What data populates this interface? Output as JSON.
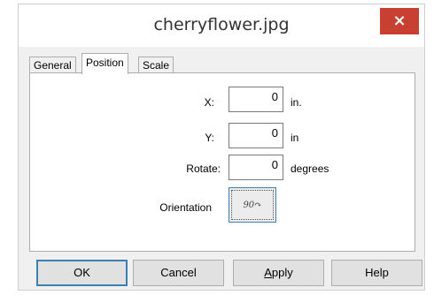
{
  "window": {
    "title": "cherryflower.jpg",
    "close_label": "×"
  },
  "tabs": [
    {
      "label": "General",
      "active": false
    },
    {
      "label": "Position",
      "active": true
    },
    {
      "label": "Scale",
      "active": false
    }
  ],
  "position": {
    "x_label": "X:",
    "x_value": "0",
    "x_unit": "in.",
    "y_label": "Y:",
    "y_value": "0",
    "y_unit": "in",
    "rotate_label": "Rotate:",
    "rotate_value": "0",
    "rotate_unit": "degrees",
    "orientation_label": "Orientation",
    "orientation_glyph": "90↷"
  },
  "buttons": {
    "ok": "OK",
    "cancel": "Cancel",
    "apply_first": "A",
    "apply_rest": "pply",
    "help": "Help"
  },
  "colors": {
    "close_button": "#c84031",
    "focus_border": "#3c7fb1"
  }
}
